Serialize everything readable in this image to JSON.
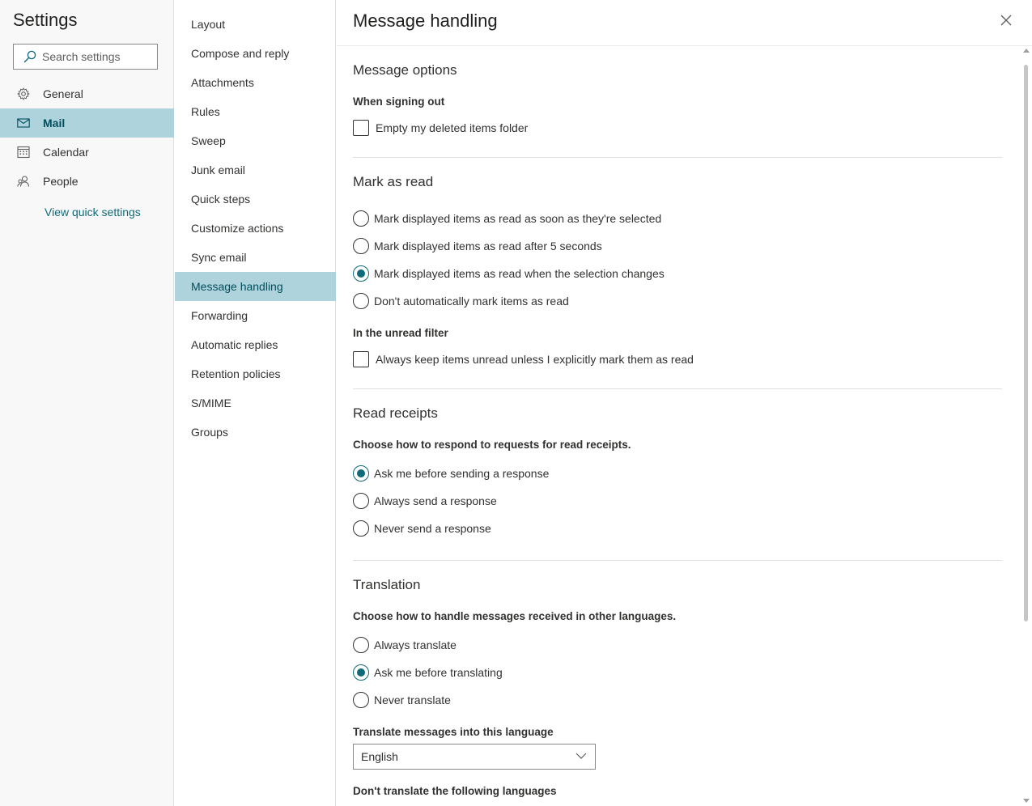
{
  "settings": {
    "title": "Settings",
    "search_placeholder": "Search settings",
    "items": [
      {
        "label": "General"
      },
      {
        "label": "Mail"
      },
      {
        "label": "Calendar"
      },
      {
        "label": "People"
      }
    ],
    "quick_link": "View quick settings"
  },
  "categories": [
    "Layout",
    "Compose and reply",
    "Attachments",
    "Rules",
    "Sweep",
    "Junk email",
    "Quick steps",
    "Customize actions",
    "Sync email",
    "Message handling",
    "Forwarding",
    "Automatic replies",
    "Retention policies",
    "S/MIME",
    "Groups"
  ],
  "page_title": "Message handling",
  "sections": {
    "message_options": {
      "heading": "Message options",
      "signing_out_label": "When signing out",
      "empty_deleted": {
        "label": "Empty my deleted items folder",
        "checked": false
      }
    },
    "mark_as_read": {
      "heading": "Mark as read",
      "options": [
        {
          "label": "Mark displayed items as read as soon as they're selected",
          "selected": false
        },
        {
          "label": "Mark displayed items as read after 5 seconds",
          "selected": false
        },
        {
          "label": "Mark displayed items as read when the selection changes",
          "selected": true
        },
        {
          "label": "Don't automatically mark items as read",
          "selected": false
        }
      ],
      "unread_filter_label": "In the unread filter",
      "keep_unread": {
        "label": "Always keep items unread unless I explicitly mark them as read",
        "checked": false
      }
    },
    "read_receipts": {
      "heading": "Read receipts",
      "description": "Choose how to respond to requests for read receipts.",
      "options": [
        {
          "label": "Ask me before sending a response",
          "selected": true
        },
        {
          "label": "Always send a response",
          "selected": false
        },
        {
          "label": "Never send a response",
          "selected": false
        }
      ]
    },
    "translation": {
      "heading": "Translation",
      "description": "Choose how to handle messages received in other languages.",
      "options": [
        {
          "label": "Always translate",
          "selected": false
        },
        {
          "label": "Ask me before translating",
          "selected": true
        },
        {
          "label": "Never translate",
          "selected": false
        }
      ],
      "language_label": "Translate messages into this language",
      "language_value": "English",
      "dont_translate_label": "Don't translate the following languages"
    }
  },
  "colors": {
    "accent": "#0f6a7a",
    "selected_bg": "#afd3dc"
  }
}
